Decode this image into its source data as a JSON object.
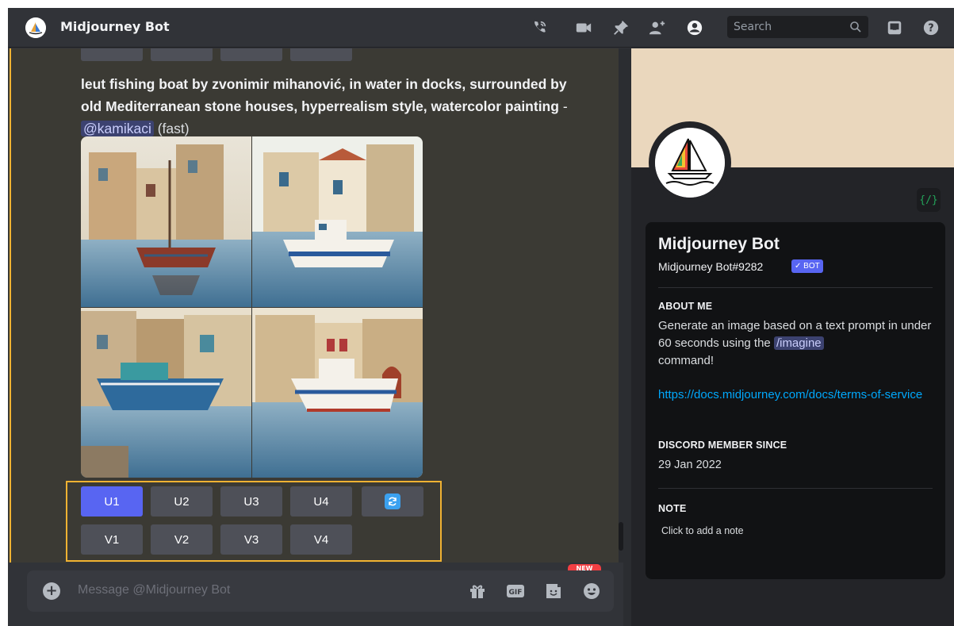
{
  "titlebar": {
    "title": "Midjourney Bot",
    "search_placeholder": "Search"
  },
  "message": {
    "prompt_text": "leut fishing boat by zvonimir mihanović, in water in docks, surrounded by old Mediterranean stone houses, hyperrealism style, watercolor painting",
    "separator": " - ",
    "mention": "@kamikaci",
    "mode": "(fast)"
  },
  "actions": {
    "upscale": [
      "U1",
      "U2",
      "U3",
      "U4"
    ],
    "variation": [
      "V1",
      "V2",
      "V3",
      "V4"
    ]
  },
  "composer": {
    "placeholder": "Message @Midjourney Bot",
    "new_badge": "NEW"
  },
  "profile": {
    "display_name": "Midjourney Bot",
    "tag": "Midjourney Bot#9282",
    "bot_badge": "✓ BOT",
    "dev_badge": "{/}",
    "about_heading": "ABOUT ME",
    "about_text_1": "Generate an image based on a text prompt in under 60 seconds using the ",
    "about_command": "/imagine",
    "about_text_2": "command!",
    "link": "https://docs.midjourney.com/docs/terms-of-service",
    "member_since_heading": "DISCORD MEMBER SINCE",
    "member_since": "29 Jan 2022",
    "note_heading": "NOTE",
    "note_placeholder": "Click to add a note"
  },
  "colors": {
    "accent_blurple": "#5865f2",
    "highlight_yellow": "#f0b232",
    "link_blue": "#00a8fc",
    "banner": "#ead7bd"
  }
}
